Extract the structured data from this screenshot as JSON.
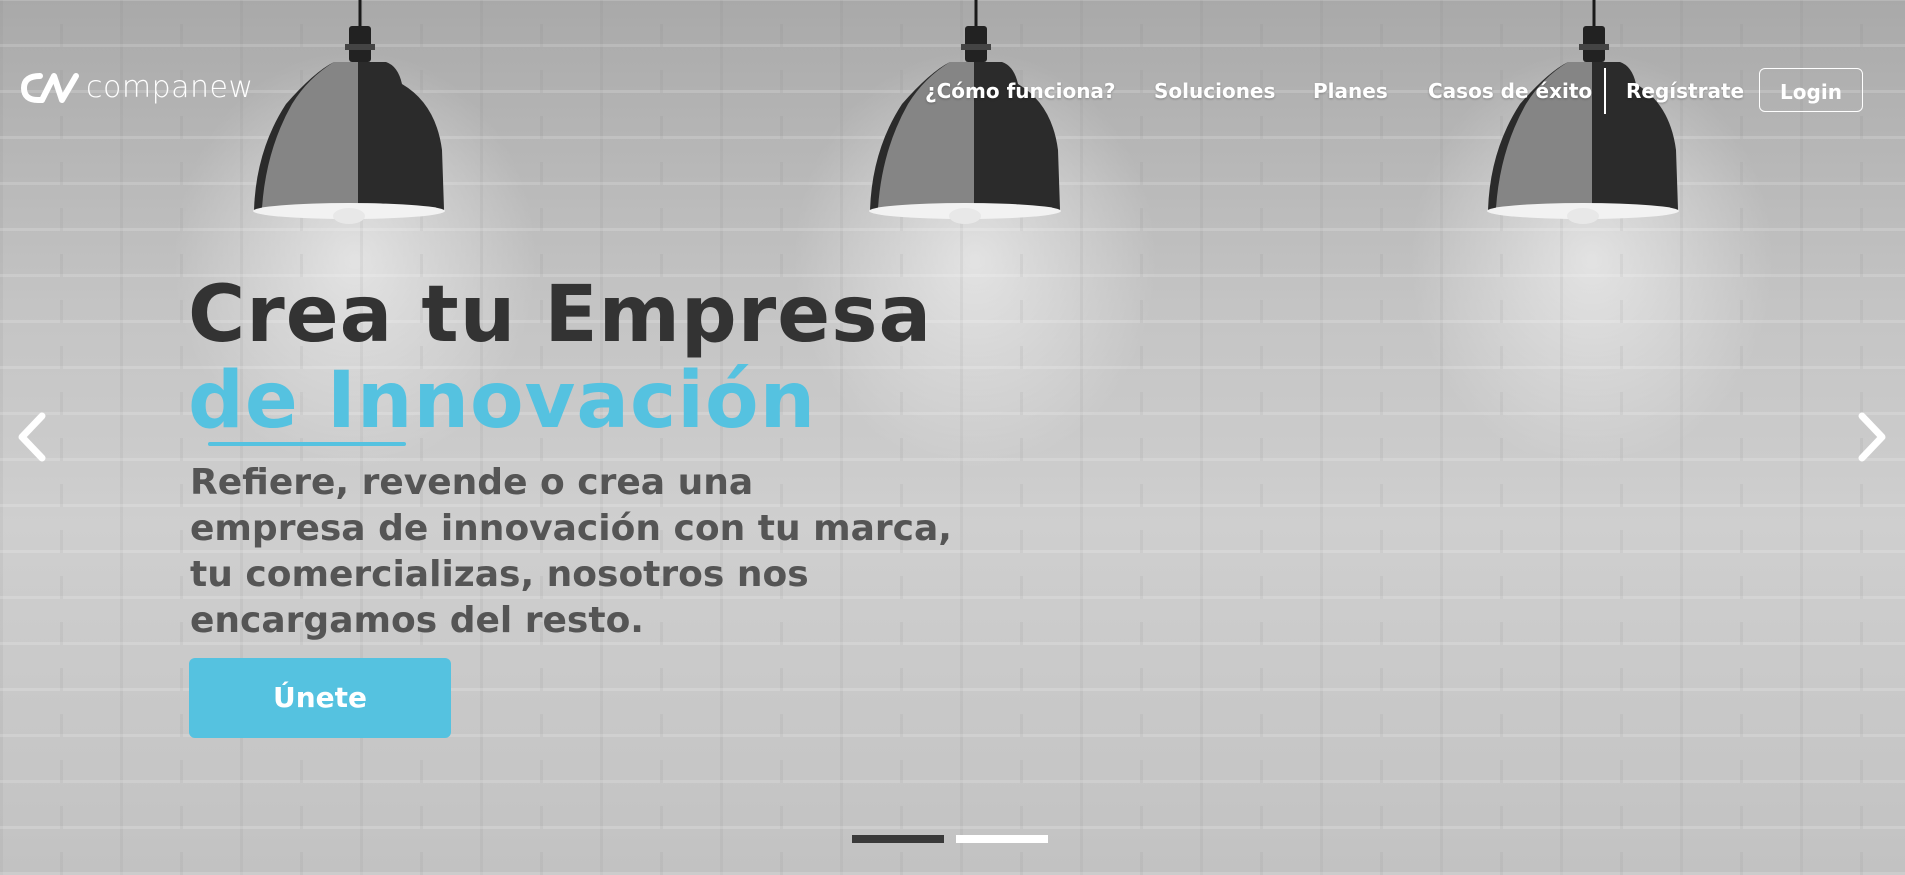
{
  "brand": {
    "name": "companew",
    "logo_icon": "companew-logo-icon"
  },
  "nav": {
    "items": [
      {
        "label": "¿Cómo funciona?"
      },
      {
        "label": "Soluciones"
      },
      {
        "label": "Planes"
      },
      {
        "label": "Casos de éxito"
      },
      {
        "label": "Regístrate"
      }
    ],
    "login_label": "Login"
  },
  "hero": {
    "headline": "Crea tu Empresa",
    "headline_accent": "de Innovación",
    "subtitle": "Refiere, revende o crea una\nempresa de innovación con tu marca,\ntu comercializas, nosotros nos\nencargamos del resto.",
    "cta_label": "Únete"
  },
  "carousel": {
    "prev_icon": "chevron-left-icon",
    "next_icon": "chevron-right-icon",
    "slide_count": 2,
    "active_index": 0
  },
  "colors": {
    "accent": "#55c2e0",
    "headline": "#333333",
    "subtitle": "#555555",
    "nav_text": "#ffffff",
    "indicator_active": "#3a3a3a",
    "indicator_inactive": "#ffffff"
  }
}
